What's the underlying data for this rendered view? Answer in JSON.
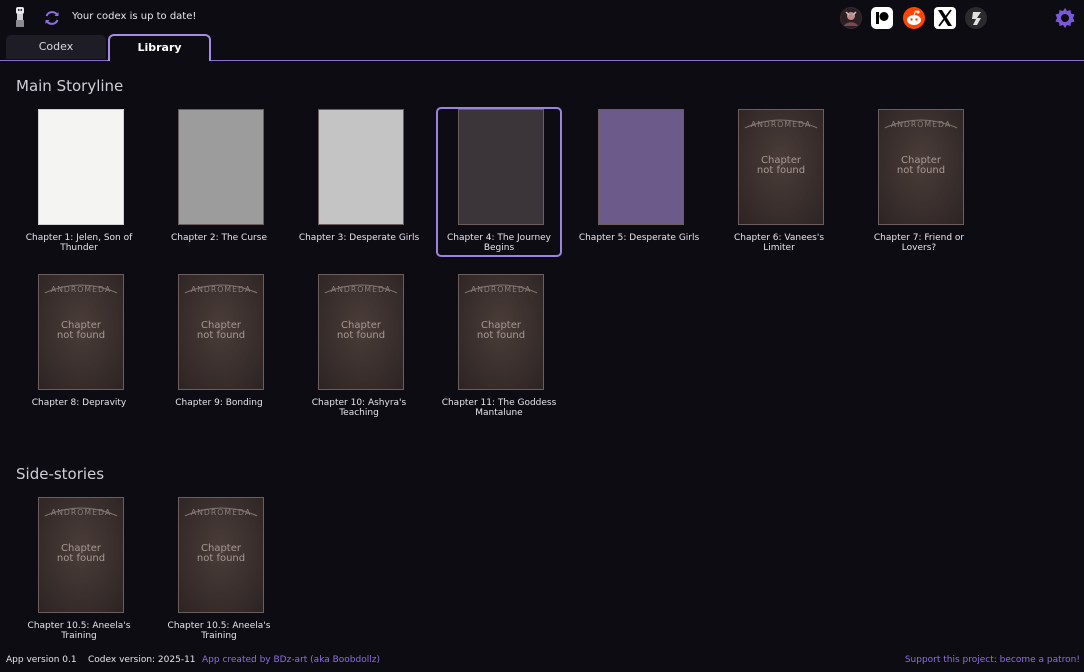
{
  "header": {
    "status": "Your codex is up to date!",
    "app_logo_icon": "mascot-logo-icon",
    "sync_icon": "sync-icon",
    "socials": [
      {
        "name": "avatar-link",
        "icon": "avatar-icon",
        "color": "#5a3a3a"
      },
      {
        "name": "patreon-link",
        "icon": "patreon-icon",
        "color": "#ffffff"
      },
      {
        "name": "reddit-link",
        "icon": "reddit-icon",
        "color": "#ff4500"
      },
      {
        "name": "x-link",
        "icon": "x-icon",
        "color": "#ffffff"
      },
      {
        "name": "deviantart-link",
        "icon": "deviantart-icon",
        "color": "#2a2a2a"
      }
    ],
    "settings_icon": "gear-icon"
  },
  "tabs": [
    {
      "label": "Codex",
      "active": false
    },
    {
      "label": "Library",
      "active": true
    }
  ],
  "library": {
    "main_title": "Main Storyline",
    "side_title": "Side-stories",
    "not_found_text": "Chapter\nnot found",
    "brand_text": "ANDROMEDA",
    "main": [
      {
        "label": "Chapter 1: Jelen, Son of Thunder",
        "found": true,
        "style": "white"
      },
      {
        "label": "Chapter 2: The Curse",
        "found": true,
        "style": "gray"
      },
      {
        "label": "Chapter 3: Desperate Girls",
        "found": true,
        "style": "lightgray"
      },
      {
        "label": "Chapter 4: The Journey Begins",
        "found": true,
        "style": "dark",
        "selected": true
      },
      {
        "label": "Chapter 5: Desperate Girls",
        "found": true,
        "style": "color"
      },
      {
        "label": "Chapter 6: Vanees's Limiter",
        "found": false
      },
      {
        "label": "Chapter 7: Friend or Lovers?",
        "found": false
      },
      {
        "label": "Chapter 8: Depravity",
        "found": false
      },
      {
        "label": "Chapter 9: Bonding",
        "found": false
      },
      {
        "label": "Chapter 10: Ashyra's Teaching",
        "found": false
      },
      {
        "label": "Chapter 11: The Goddess Mantalune",
        "found": false
      }
    ],
    "side": [
      {
        "label": "Chapter 10.5: Aneela's Training",
        "found": false
      },
      {
        "label": "Chapter 10.5: Aneela's Training",
        "found": false
      }
    ]
  },
  "footer": {
    "app_version": "App version 0.1",
    "codex_version": "Codex version: 2025-11",
    "credit": "App created by BDz-art (aka Boobdollz)",
    "support": "Support this project: become a patron!"
  },
  "colors": {
    "accent": "#9b84e0",
    "background": "#0d0c12",
    "link": "#8e6fe0"
  }
}
